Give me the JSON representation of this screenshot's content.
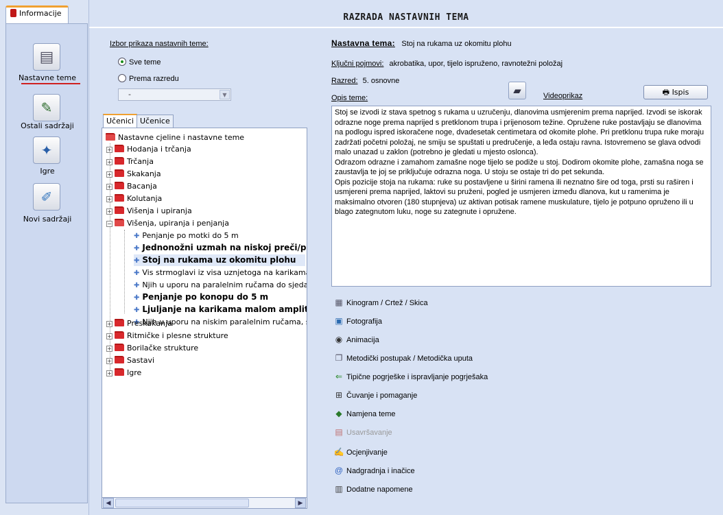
{
  "sidebar": {
    "tab_label": "Informacije",
    "items": [
      {
        "label": "Nastavne teme",
        "icon": "document-icon",
        "active": true
      },
      {
        "label": "Ostali sadržaji",
        "icon": "edit-document-icon",
        "active": false
      },
      {
        "label": "Igre",
        "icon": "game-icon",
        "active": false
      },
      {
        "label": "Novi sadržaji",
        "icon": "new-content-icon",
        "active": false
      }
    ]
  },
  "header": {
    "title": "RAZRADA NASTAVNIH TEMA"
  },
  "filter": {
    "label": "Izbor prikaza nastavnih teme:",
    "option_all": "Sve teme",
    "option_grade": "Prema razredu",
    "selected": "Sve teme",
    "grade_select_value": "-"
  },
  "tree_tabs": [
    "Učenici",
    "Učenice"
  ],
  "tree": {
    "root": "Nastavne cjeline i nastavne teme",
    "groups": [
      "Hodanja i trčanja",
      "Trčanja",
      "Skakanja",
      "Bacanja",
      "Kolutanja",
      "Višenja i upiranja",
      "Višenja, upiranja i penjanja"
    ],
    "children": [
      {
        "label": "Penjanje po motki do 5 m",
        "bold": false
      },
      {
        "label": "Jednonožni uzmah na niskoj preči/pritk",
        "bold": true
      },
      {
        "label": "Stoj na rukama uz okomitu plohu",
        "bold": true,
        "selected": true
      },
      {
        "label": "Vis strmoglavi iz visa uznjetoga na karikama",
        "bold": false
      },
      {
        "label": "Njih u uporu na paralelnim ručama do sjeda ra",
        "bold": false
      },
      {
        "label": "Penjanje po konopu do 5 m",
        "bold": true
      },
      {
        "label": "Ljuljanje na karikama malom amplitude",
        "bold": true
      },
      {
        "label": "Njih u uporu na niskim paralelnim ručama, sask",
        "bold": false
      }
    ],
    "groups_after": [
      "Preskakanja",
      "Ritmičke i plesne strukture",
      "Borilačke strukture",
      "Sastavi",
      "Igre"
    ]
  },
  "detail": {
    "topic_label": "Nastavna tema:",
    "topic_value": "Stoj na rukama uz okomitu plohu",
    "keywords_label": "Ključni pojmovi:",
    "keywords_value": "akrobatika, upor, tijelo ispruženo, ravnotežni položaj",
    "grade_label": "Razred:",
    "grade_value": "5. osnovne",
    "desc_label": "Opis teme:",
    "video_label": "Videoprikaz",
    "print_label": "Ispis",
    "description": [
      "Stoj se izvodi iz stava spetnog s rukama u uzručenju, dlanovima usmjerenim prema naprijed. Izvodi se iskorak odrazne noge prema naprijed s pretklonom trupa i prijenosom težine. Opružene ruke postavljaju se dlanovima na podlogu ispred iskoračene noge, dvadesetak centimetara od okomite plohe. Pri pretklonu trupa ruke moraju zadržati početni položaj, ne smiju se spuštati u predručenje, a leđa ostaju ravna. Istovremeno se glava odvodi malo unazad u zaklon (potrebno je gledati u mjesto oslonca).",
      "Odrazom odrazne i zamahom zamašne noge tijelo se podiže u stoj. Dodirom okomite plohe, zamašna noga se zaustavlja te joj se priključuje odrazna noga. U stoju se ostaje tri do pet sekunda.",
      "Opis pozicije stoja na rukama: ruke su postavljene u širini ramena ili neznatno šire od toga, prsti su raširen i usmjereni prema naprijed, laktovi su pruženi, pogled je usmjeren između dlanova, kut u ramenima je maksimalno otvoren (180 stupnjeva) uz aktivan potisak ramene muskulature, tijelo je potpuno opruženo ili u blago zategnutom luku, noge su zategnute i opružene."
    ]
  },
  "resources": [
    {
      "label": "Kinogram / Crtež / Skica",
      "icon": "film-icon",
      "enabled": true
    },
    {
      "label": "Fotografija",
      "icon": "photo-icon",
      "enabled": true
    },
    {
      "label": "Animacija",
      "icon": "animation-icon",
      "enabled": true
    },
    {
      "label": "Metodički postupak  / Metodička uputa",
      "icon": "method-icon",
      "enabled": true
    },
    {
      "label": "Tipične pogrješke i ispravljanje pogrješaka",
      "icon": "errors-icon",
      "enabled": true
    },
    {
      "label": "Čuvanje i pomaganje",
      "icon": "safety-icon",
      "enabled": true
    },
    {
      "label": "Namjena teme",
      "icon": "purpose-icon",
      "enabled": true
    },
    {
      "label": "Usavršavanje",
      "icon": "calendar-icon",
      "enabled": false
    },
    {
      "label": "Ocjenjivanje",
      "icon": "grading-icon",
      "enabled": true
    },
    {
      "label": "Nadgradnja i inačice",
      "icon": "upgrade-icon",
      "enabled": true
    },
    {
      "label": "Dodatne napomene",
      "icon": "notes-icon",
      "enabled": true
    }
  ]
}
